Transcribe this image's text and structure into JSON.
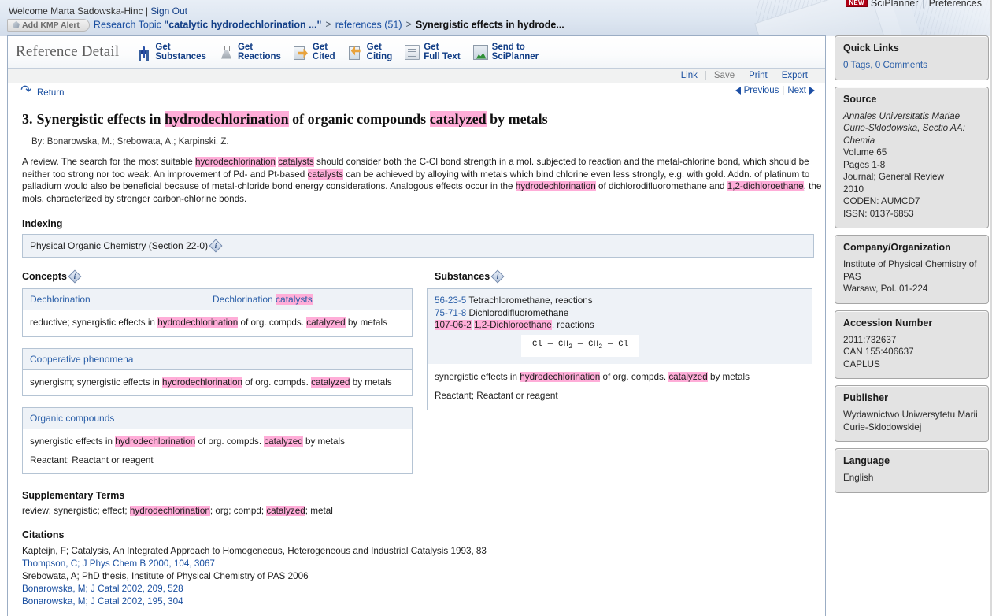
{
  "header": {
    "welcome_text": "Welcome Marta Sadowska-Hinc | ",
    "sign_out": "Sign Out",
    "new_badge": "NEW",
    "sciplanner": "SciPlanner",
    "preferences": "Preferences"
  },
  "breadcrumb": {
    "kmp_alert": "Add KMP Alert",
    "research_topic_label": "Research Topic ",
    "research_topic_query": "\"catalytic hydrodechlorination ...\"",
    "references": "references (51)",
    "current": "Synergistic effects in hydrode...",
    "separator": ">"
  },
  "toolbar": {
    "panel_title": "Reference Detail",
    "buttons": [
      {
        "line1": "Get",
        "line2": "Substances",
        "icon": "substances-icon"
      },
      {
        "line1": "Get",
        "line2": "Reactions",
        "icon": "reactions-flask-icon"
      },
      {
        "line1": "Get",
        "line2": "Cited",
        "icon": "get-cited-icon"
      },
      {
        "line1": "Get",
        "line2": "Citing",
        "icon": "get-citing-icon"
      },
      {
        "line1": "Get",
        "line2": "Full Text",
        "icon": "document-icon"
      },
      {
        "line1": "Send to",
        "line2": "SciPlanner",
        "icon": "sciplanner-icon"
      }
    ]
  },
  "linkbar": {
    "link": "Link",
    "save": "Save",
    "print": "Print",
    "export": "Export"
  },
  "nav": {
    "return": "Return",
    "previous": "Previous",
    "next": "Next"
  },
  "record": {
    "number": "3.",
    "title_parts": [
      {
        "t": "Synergistic effects in ",
        "h": false
      },
      {
        "t": "hydrodechlorination",
        "h": true
      },
      {
        "t": " of organic compounds ",
        "h": false
      },
      {
        "t": "catalyzed",
        "h": true
      },
      {
        "t": " by metals",
        "h": false
      }
    ],
    "title_plain": "Synergistic effects in hydrodechlorination of organic compounds catalyzed by metals",
    "authors": "By: Bonarowska, M.; Srebowata, A.; Karpinski, Z.",
    "abstract_plain": "A review.  The search for the most suitable hydrodechlorination catalysts should consider both the C-Cl bond strength in a mol. subjected to reaction and the metal-chlorine bond, which should be neither too strong nor too weak.  An improvement of Pd- and Pt-based catalysts can be achieved by alloying with metals which bind chlorine even less strongly, e.g. with gold.  Addn. of platinum to palladium would also be beneficial because of metal-chloride bond energy considerations.  Analogous effects occur in the hydrodechlorination of dichlorodifluoromethane and 1,2-dichloroethane, the mols. characterized by stronger carbon-chlorine bonds."
  },
  "indexing": {
    "heading": "Indexing",
    "value": "Physical Organic Chemistry (Section 22-0)"
  },
  "concepts": {
    "heading": "Concepts",
    "cards": [
      {
        "head_left": "Dechlorination",
        "head_right": "Dechlorination catalysts",
        "head_right_highlight": "catalysts",
        "body": [
          "reductive; synergistic effects in hydrodechlorination of org. compds. catalyzed by metals"
        ]
      },
      {
        "head_left": "Cooperative phenomena",
        "head_right": "",
        "body": [
          "synergism; synergistic effects in hydrodechlorination of org. compds. catalyzed by metals"
        ]
      },
      {
        "head_left": "Organic compounds",
        "head_right": "",
        "body": [
          "synergistic effects in hydrodechlorination of org. compds. catalyzed by metals",
          "Reactant; Reactant or reagent"
        ]
      }
    ]
  },
  "substances": {
    "heading": "Substances",
    "entries": [
      {
        "cas": "56-23-5",
        "name": "Tetrachloromethane, reactions",
        "cas_highlight": false,
        "name_highlight": false
      },
      {
        "cas": "75-71-8",
        "name": "Dichlorodifluoromethane",
        "cas_highlight": false,
        "name_highlight": false
      },
      {
        "cas": "107-06-2",
        "name": "1,2-Dichloroethane, reactions",
        "cas_highlight": true,
        "name_highlight": true
      }
    ],
    "structure": "Cl — CH2 — CH2 — Cl",
    "notes": [
      "synergistic effects in hydrodechlorination of org. compds. catalyzed by metals",
      "Reactant; Reactant or reagent"
    ]
  },
  "supplementary": {
    "heading": "Supplementary Terms",
    "text": "review; synergistic; effect; hydrodechlorination; org; compd; catalyzed; metal"
  },
  "citations": {
    "heading": "Citations",
    "items": [
      {
        "text": "Kapteijn, F; Catalysis, An Integrated Approach to Homogeneous, Heterogeneous and Industrial Catalysis 1993, 83",
        "link": false
      },
      {
        "text": "Thompson, C; J Phys Chem B 2000, 104, 3067",
        "link": true
      },
      {
        "text": "Srebowata, A; PhD thesis, Institute of Physical Chemistry of PAS 2006",
        "link": false
      },
      {
        "text": "Bonarowska, M; J Catal 2002, 209, 528",
        "link": true
      },
      {
        "text": "Bonarowska, M; J Catal 2002, 195, 304",
        "link": true
      }
    ]
  },
  "sidebar": {
    "quick_links": {
      "title": "Quick Links",
      "value": "0 Tags, 0 Comments"
    },
    "source": {
      "title": "Source",
      "journal": "Annales Universitatis Mariae Curie-Sklodowska, Sectio AA: Chemia",
      "lines": [
        "Volume 65",
        "Pages 1-8",
        "Journal; General Review",
        "2010",
        "CODEN: AUMCD7",
        "ISSN: 0137-6853"
      ]
    },
    "company": {
      "title": "Company/Organization",
      "lines": [
        "Institute of Physical Chemistry of PAS",
        "Warsaw, Pol.  01-224"
      ]
    },
    "accession": {
      "title": "Accession Number",
      "lines": [
        "2011:732637",
        "CAN 155:406637",
        "CAPLUS"
      ]
    },
    "publisher": {
      "title": "Publisher",
      "lines": [
        "Wydawnictwo Uniwersytetu Marii Curie-Sklodowskiej"
      ]
    },
    "language": {
      "title": "Language",
      "value": "English"
    }
  },
  "colors": {
    "highlight_pink": "#ffadd8",
    "link_blue": "#1a4fa0",
    "panel_blue": "#eef2f7",
    "sidebar_grey": "#e3e3e3"
  }
}
